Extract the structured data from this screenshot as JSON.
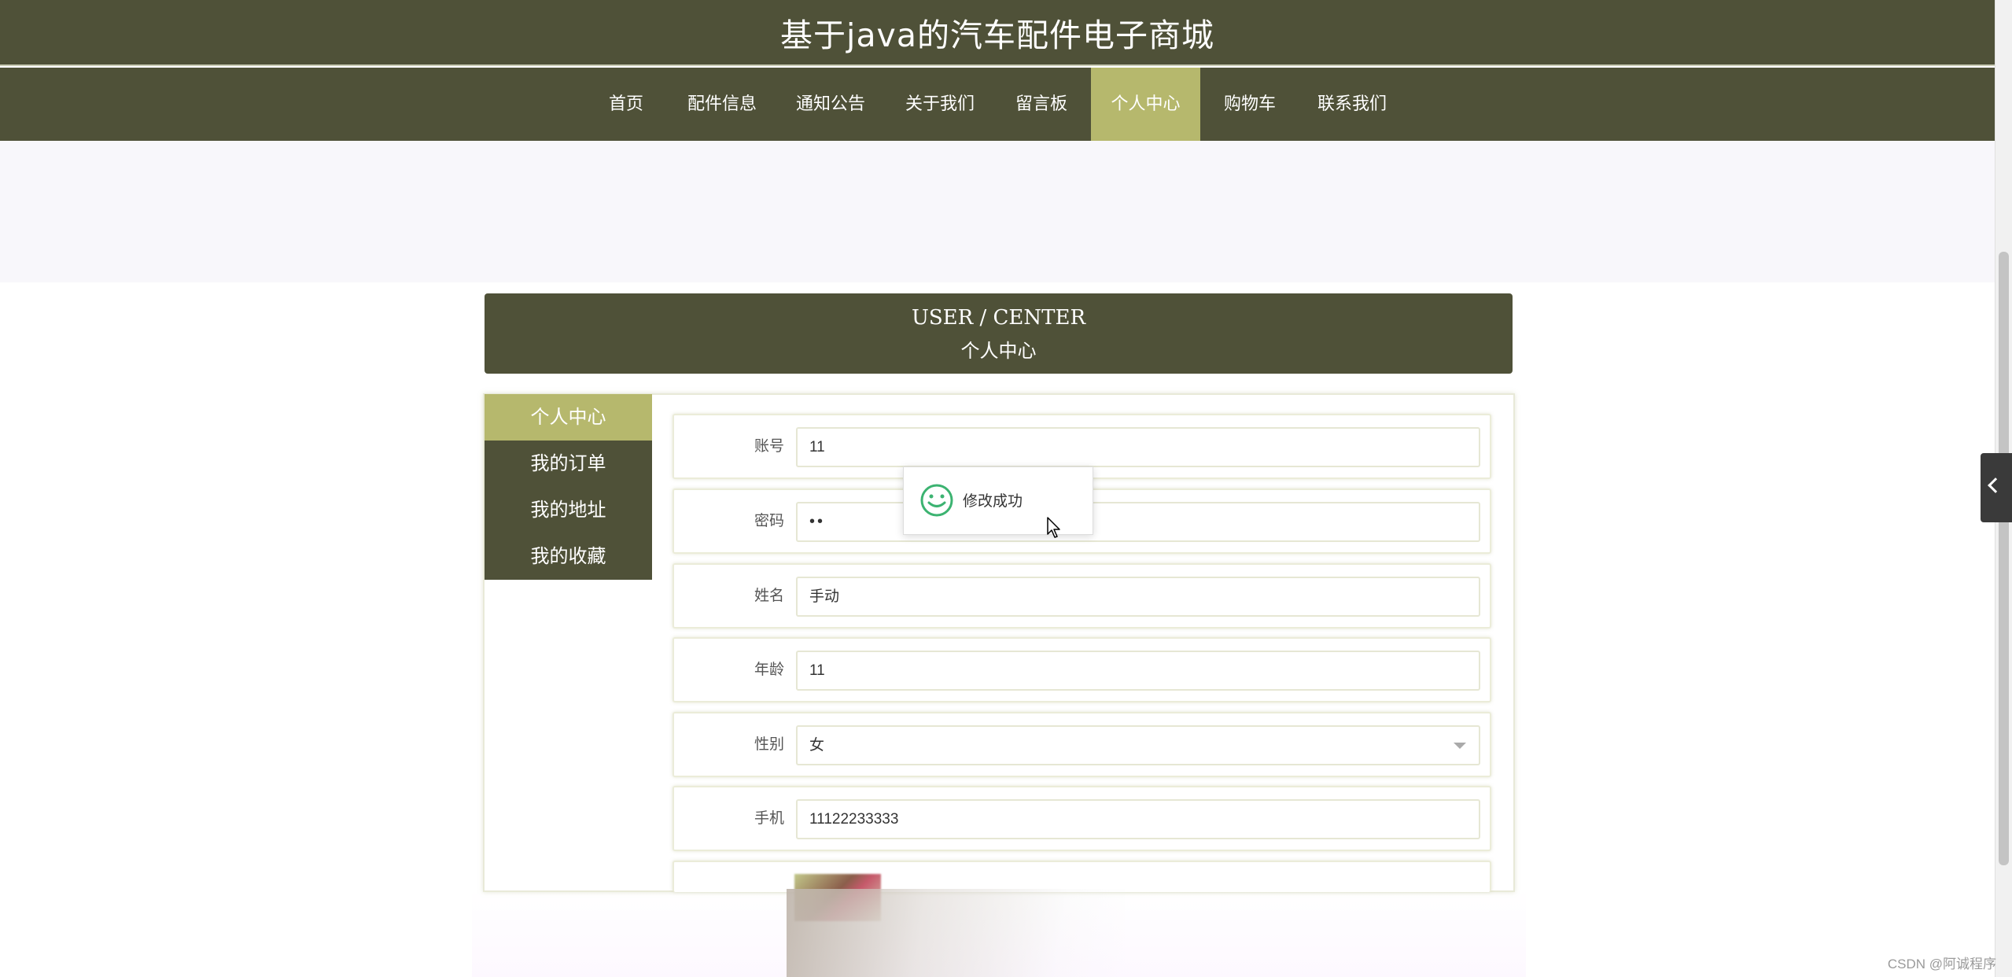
{
  "site": {
    "title": "基于java的汽车配件电子商城"
  },
  "nav": {
    "items": [
      {
        "label": "首页",
        "active": false
      },
      {
        "label": "配件信息",
        "active": false
      },
      {
        "label": "通知公告",
        "active": false
      },
      {
        "label": "关于我们",
        "active": false
      },
      {
        "label": "留言板",
        "active": false
      },
      {
        "label": "个人中心",
        "active": true
      },
      {
        "label": "购物车",
        "active": false
      },
      {
        "label": "联系我们",
        "active": false
      }
    ]
  },
  "section": {
    "title_en": "USER / CENTER",
    "title_cn": "个人中心"
  },
  "sidebar": {
    "items": [
      {
        "label": "个人中心",
        "active": true
      },
      {
        "label": "我的订单",
        "active": false
      },
      {
        "label": "我的地址",
        "active": false
      },
      {
        "label": "我的收藏",
        "active": false
      }
    ]
  },
  "form": {
    "account": {
      "label": "账号",
      "value": "11"
    },
    "password": {
      "label": "密码",
      "value": "••"
    },
    "name": {
      "label": "姓名",
      "value": "手动"
    },
    "age": {
      "label": "年龄",
      "value": "11"
    },
    "gender": {
      "label": "性别",
      "value": "女"
    },
    "phone": {
      "label": "手机",
      "value": "11122233333"
    }
  },
  "toast": {
    "message": "修改成功"
  },
  "watermark": "CSDN @阿诚程序",
  "colors": {
    "header_bg": "#4f5138",
    "accent": "#b6b86d",
    "toast_icon": "#3cb371"
  }
}
